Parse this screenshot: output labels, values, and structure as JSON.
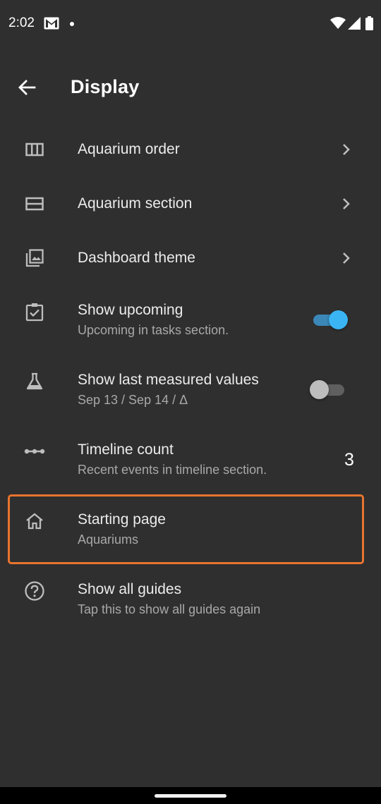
{
  "status_bar": {
    "time": "2:02",
    "notification_icons": [
      "gmail-icon",
      "dot-icon"
    ],
    "system_icons": [
      "wifi-icon",
      "signal-icon",
      "battery-icon"
    ]
  },
  "app_bar": {
    "back_icon": "arrow-back-icon",
    "title": "Display"
  },
  "settings": {
    "aquarium_order": {
      "icon": "view-column-icon",
      "title": "Aquarium order",
      "trailing": "chevron-right-icon"
    },
    "aquarium_section": {
      "icon": "view-agenda-icon",
      "title": "Aquarium section",
      "trailing": "chevron-right-icon"
    },
    "dashboard_theme": {
      "icon": "photo-library-icon",
      "title": "Dashboard theme",
      "trailing": "chevron-right-icon"
    },
    "show_upcoming": {
      "icon": "checkbox-icon",
      "title": "Show upcoming",
      "subtitle": "Upcoming in tasks section.",
      "enabled": true
    },
    "show_last_measured": {
      "icon": "flask-icon",
      "title": "Show last measured values",
      "subtitle": "Sep 13 / Sep 14 / Δ",
      "enabled": false
    },
    "timeline_count": {
      "icon": "timeline-dots-icon",
      "title": "Timeline count",
      "subtitle": "Recent events in timeline section.",
      "value": "3"
    },
    "starting_page": {
      "icon": "home-icon",
      "title": "Starting page",
      "subtitle": "Aquariums"
    },
    "show_all_guides": {
      "icon": "help-circle-icon",
      "title": "Show all guides",
      "subtitle": "Tap this to show all guides again"
    }
  },
  "colors": {
    "background": "#2f2f2f",
    "toggle_on": "#3ab4f2",
    "highlight": "#e8742e"
  }
}
